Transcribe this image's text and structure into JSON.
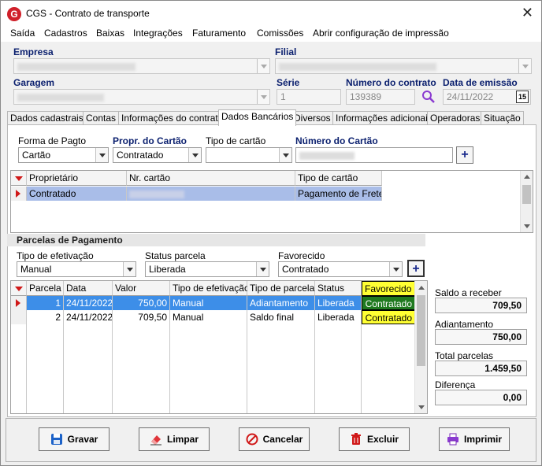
{
  "window": {
    "title": "CGS - Contrato de transporte",
    "logo": "G"
  },
  "menu": [
    "Saída",
    "Cadastros",
    "Baixas",
    "Integrações",
    "Faturamento",
    "Comissões",
    "Abrir configuração de impressão"
  ],
  "header": {
    "empresa_label": "Empresa",
    "filial_label": "Filial",
    "garagem_label": "Garagem",
    "serie_label": "Série",
    "serie_value": "1",
    "numero_label": "Número do contrato",
    "numero_value": "139389",
    "emissao_label": "Data de emissão",
    "emissao_value": "24/11/2022"
  },
  "tabs": [
    "Dados cadastrais",
    "Contas",
    "Informações do contrato",
    "Dados Bancários",
    "Diversos",
    "Informações adicionais",
    "Operadoras",
    "Situação"
  ],
  "bank": {
    "forma_label": "Forma de Pagto",
    "forma_value": "Cartão",
    "propr_label": "Propr. do Cartão",
    "propr_value": "Contratado",
    "tipo_label": "Tipo de cartão",
    "tipo_value": "",
    "numero_label": "Número do Cartão",
    "plus": "+",
    "grid_headers": [
      "Proprietário",
      "Nr. cartão",
      "Tipo de cartão"
    ],
    "grid_row": {
      "proprietario": "Contratado",
      "tipo": "Pagamento de Frete"
    }
  },
  "parcelas": {
    "section_title": "Parcelas de Pagamento",
    "tipo_label": "Tipo de efetivação",
    "tipo_value": "Manual",
    "status_label": "Status parcela",
    "status_value": "Liberada",
    "fav_label": "Favorecido",
    "fav_value": "Contratado",
    "plus": "+",
    "headers": [
      "Parcela",
      "Data",
      "Valor",
      "Tipo de efetivação",
      "Tipo de parcela",
      "Status",
      "Favorecido"
    ],
    "rows": [
      {
        "parcela": "1",
        "data": "24/11/2022",
        "valor": "750,00",
        "efetivacao": "Manual",
        "tipo": "Adiantamento",
        "status": "Liberada",
        "favorecido": "Contratado"
      },
      {
        "parcela": "2",
        "data": "24/11/2022",
        "valor": "709,50",
        "efetivacao": "Manual",
        "tipo": "Saldo final",
        "status": "Liberada",
        "favorecido": "Contratado"
      }
    ]
  },
  "summary": {
    "saldo_label": "Saldo a receber",
    "saldo_value": "709,50",
    "adiant_label": "Adiantamento",
    "adiant_value": "750,00",
    "total_label": "Total parcelas",
    "total_value": "1.459,50",
    "dif_label": "Diferença",
    "dif_value": "0,00"
  },
  "buttons": {
    "gravar": "Gravar",
    "limpar": "Limpar",
    "cancelar": "Cancelar",
    "excluir": "Excluir",
    "imprimir": "Imprimir"
  },
  "colors": {
    "selection": "#3d8ee8",
    "row_highlight": "#a9bde8",
    "favorecido_yellow": "#ffff33",
    "favorecido_green": "#1f7a1f",
    "label_blue": "#0a1f6e",
    "red_marker": "#d01818"
  }
}
